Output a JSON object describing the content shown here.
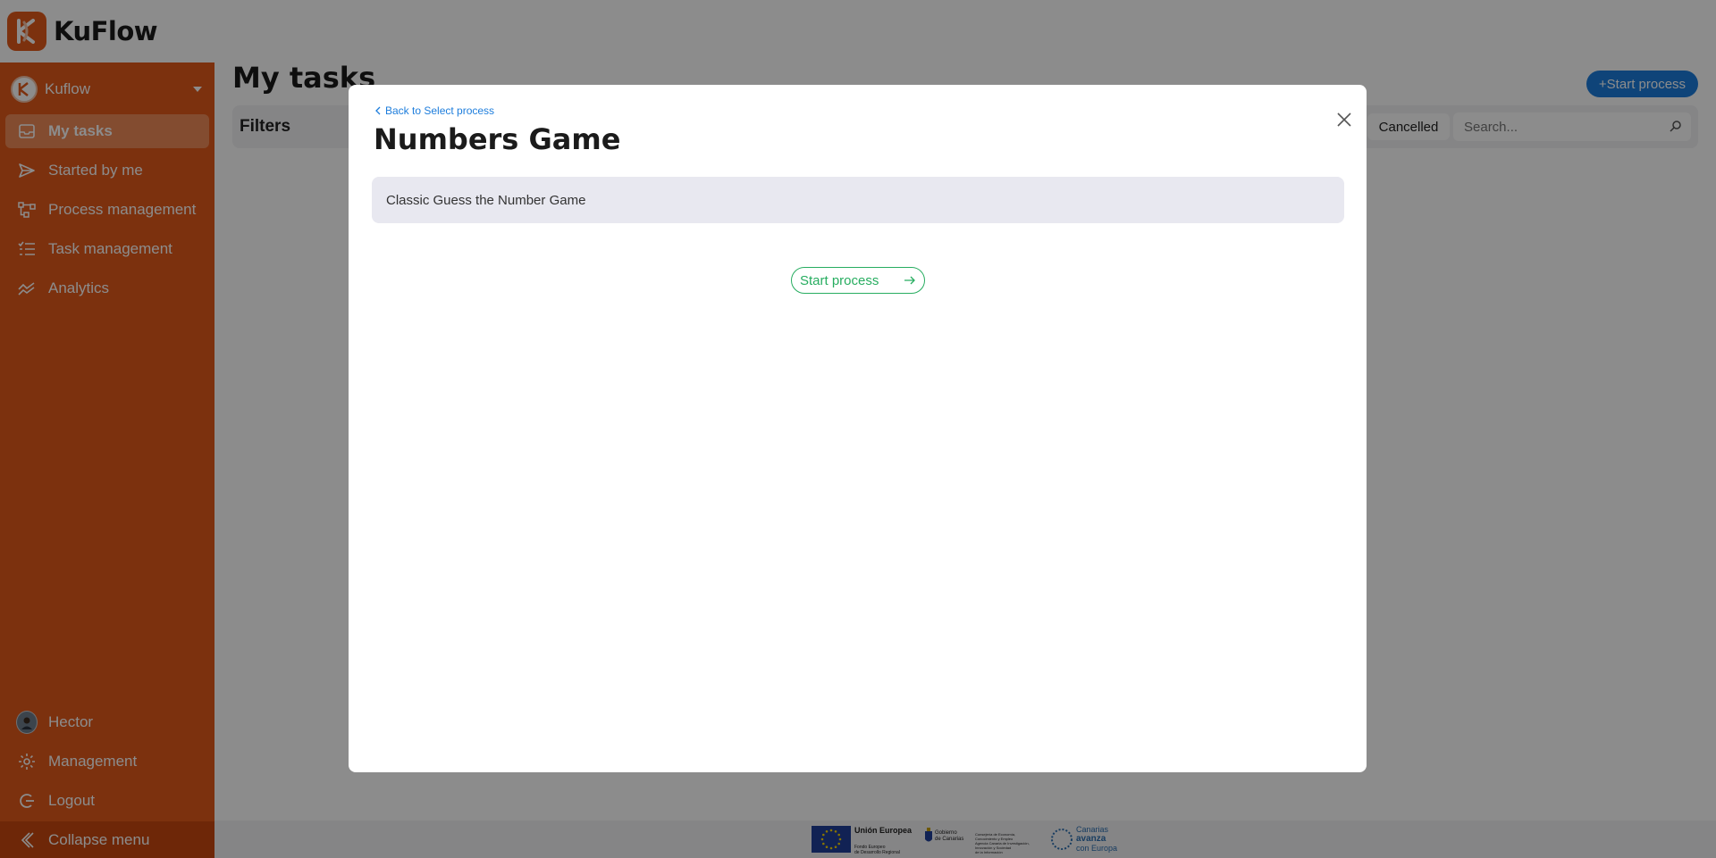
{
  "app": {
    "name": "KuFlow"
  },
  "sidebar": {
    "org": "Kuflow",
    "items": [
      {
        "label": "My tasks",
        "icon": "inbox-icon",
        "active": true
      },
      {
        "label": "Started by me",
        "icon": "send-icon"
      },
      {
        "label": "Process management",
        "icon": "process-icon"
      },
      {
        "label": "Task management",
        "icon": "checklist-icon"
      },
      {
        "label": "Analytics",
        "icon": "analytics-icon"
      }
    ],
    "bottom": [
      {
        "label": "Hector",
        "icon": "user-avatar"
      },
      {
        "label": "Management",
        "icon": "gear-icon"
      },
      {
        "label": "Logout",
        "icon": "logout-icon"
      }
    ],
    "collapse": "Collapse menu"
  },
  "main": {
    "title": "My tasks",
    "start_button": "+Start process",
    "filters_label": "Filters",
    "status_chip": "Cancelled",
    "search_placeholder": "Search..."
  },
  "modal": {
    "back_link": "Back to Select process",
    "title": "Numbers Game",
    "description": "Classic Guess the Number Game",
    "start_button": "Start process"
  },
  "footer": {
    "eu_title": "Unión Europea",
    "eu_sub1": "Fondo Europeo",
    "eu_sub2": "de Desarrollo Regional",
    "gob_line1": "Gobierno",
    "gob_line2": "de Canarias",
    "dept_line1": "Consejería de Economía,",
    "dept_line2": "Conocimiento y Empleo",
    "dept_line3": "Agencia Canaria de Investigación,",
    "dept_line4": "Innovación y Sociedad",
    "dept_line5": "de la Información",
    "canarias_line1": "Canarias",
    "canarias_line2": "avanza",
    "canarias_line3": "con Europa"
  },
  "colors": {
    "brand_orange": "#e2591a",
    "accent_blue": "#1d7ddc",
    "accent_green": "#27ad60"
  }
}
